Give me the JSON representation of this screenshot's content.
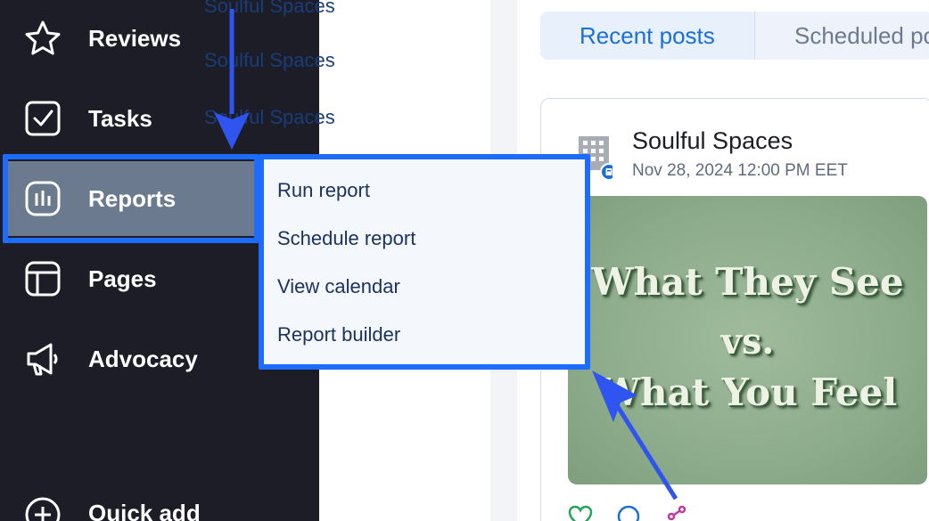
{
  "sidebar": {
    "items": [
      {
        "label": "Reviews",
        "icon": "star-icon"
      },
      {
        "label": "Tasks",
        "icon": "checkbox-icon"
      },
      {
        "label": "Reports",
        "icon": "reports-icon",
        "active": true
      },
      {
        "label": "Pages",
        "icon": "layout-icon"
      },
      {
        "label": "Advocacy",
        "icon": "megaphone-icon"
      }
    ],
    "quick_add": {
      "label": "Quick add",
      "icon": "plus-circle-icon"
    }
  },
  "middle_list": {
    "rows": [
      "Soulful Spaces",
      "Soulful Spaces",
      "Soulful Spaces"
    ]
  },
  "reports_menu": {
    "items": [
      "Run report",
      "Schedule report",
      "View calendar",
      "Report builder"
    ]
  },
  "tabs": [
    {
      "label": "Recent posts",
      "active": true
    },
    {
      "label": "Scheduled posts",
      "active": false
    }
  ],
  "post": {
    "author": "Soulful Spaces",
    "timestamp": "Nov 28, 2024 12:00 PM EET",
    "image_text": [
      "What They See",
      "vs.",
      "What You Feel"
    ],
    "actions": [
      "heart-icon",
      "comment-icon",
      "share-icon"
    ]
  },
  "colors": {
    "sidebar_bg": "#1c1d26",
    "active_bg": "#6b7a8e",
    "highlight": "#1e6bff",
    "link_blue": "#1b6fd8"
  }
}
